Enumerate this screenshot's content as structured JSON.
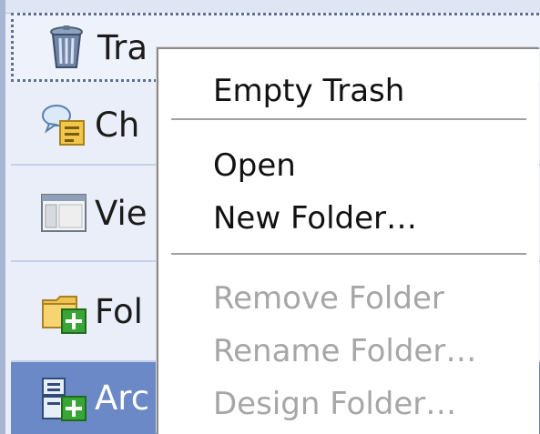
{
  "nav_pane": {
    "items": [
      {
        "label": "Tra",
        "icon": "trash-can-icon",
        "selected": true
      },
      {
        "label": "Ch",
        "icon": "chat-icon"
      },
      {
        "label": "Vie",
        "icon": "views-window-icon"
      },
      {
        "label": "Fol",
        "icon": "folder-add-icon"
      },
      {
        "label": "Arc",
        "icon": "archive-add-icon",
        "highlighted": true
      }
    ]
  },
  "context_menu": {
    "items": [
      {
        "label": "Empty Trash",
        "enabled": true
      },
      {
        "label": "Open",
        "enabled": true
      },
      {
        "label": "New Folder…",
        "enabled": true
      },
      {
        "label": "Remove Folder",
        "enabled": false
      },
      {
        "label": "Rename Folder…",
        "enabled": false
      },
      {
        "label": "Design Folder…",
        "enabled": false
      }
    ]
  },
  "colors": {
    "pane_background": "#e9eef8",
    "pane_border": "#a7b7d3",
    "highlight": "#6a89c6",
    "menu_text": "#111111",
    "menu_disabled_text": "#a6a6a6",
    "folder_green": "#3aa537"
  }
}
